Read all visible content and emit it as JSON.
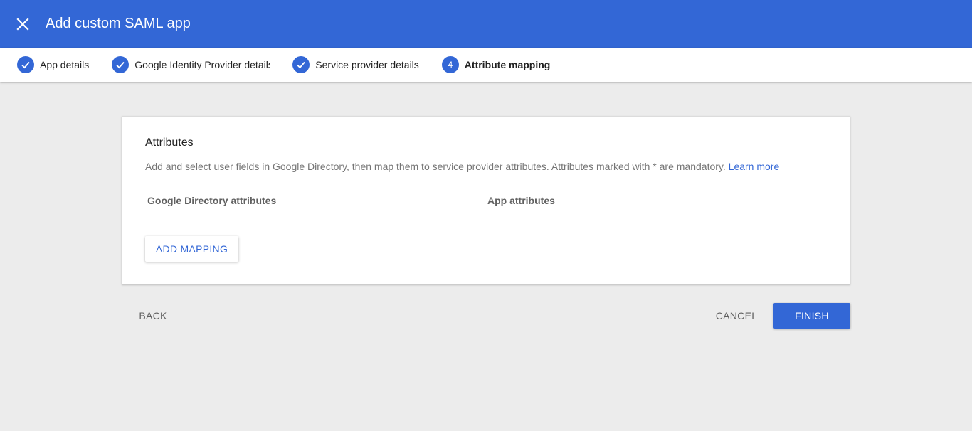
{
  "header": {
    "title": "Add custom SAML app",
    "close_icon": "close-icon"
  },
  "stepper": {
    "steps": [
      {
        "label": "App details",
        "state": "done"
      },
      {
        "label": "Google Identity Provider details",
        "state": "done"
      },
      {
        "label": "Service provider details",
        "state": "done"
      },
      {
        "label": "Attribute mapping",
        "state": "active",
        "number": "4"
      }
    ]
  },
  "card": {
    "title": "Attributes",
    "description": "Add and select user fields in Google Directory, then map them to service provider attributes. Attributes marked with * are mandatory.",
    "learn_more": "Learn more",
    "col_left": "Google Directory attributes",
    "col_right": "App attributes",
    "add_mapping": "ADD MAPPING"
  },
  "footer": {
    "back": "BACK",
    "cancel": "CANCEL",
    "finish": "FINISH"
  },
  "colors": {
    "brand": "#3367d6",
    "background": "#ececec"
  }
}
